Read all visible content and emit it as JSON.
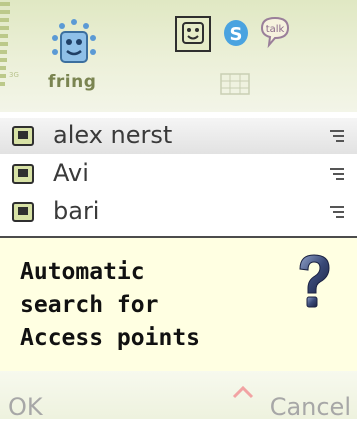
{
  "header": {
    "logo_text": "fring",
    "signal_caption": "3G"
  },
  "tabs": [
    {
      "name": "fring",
      "icon": "fring-smiley-icon",
      "selected": true
    },
    {
      "name": "skype",
      "icon": "skype-icon"
    },
    {
      "name": "gtalk",
      "icon": "gtalk-icon"
    }
  ],
  "contacts": [
    {
      "name": "alex nerst",
      "icon": "contact-card-icon"
    },
    {
      "name": "Avi",
      "icon": "contact-card-icon"
    },
    {
      "name": "bari",
      "icon": "contact-card-icon"
    }
  ],
  "dialog": {
    "lines": [
      "Automatic",
      "search for",
      "Access points"
    ],
    "icon": "question-mark-icon"
  },
  "softkeys": {
    "left": "OK",
    "right": "Cancel"
  },
  "colors": {
    "header_bg": "#e0e8c3",
    "dialog_bg": "#ffffe2",
    "accent_green": "#7a8450",
    "softkey_text": "#a7a7a7"
  }
}
